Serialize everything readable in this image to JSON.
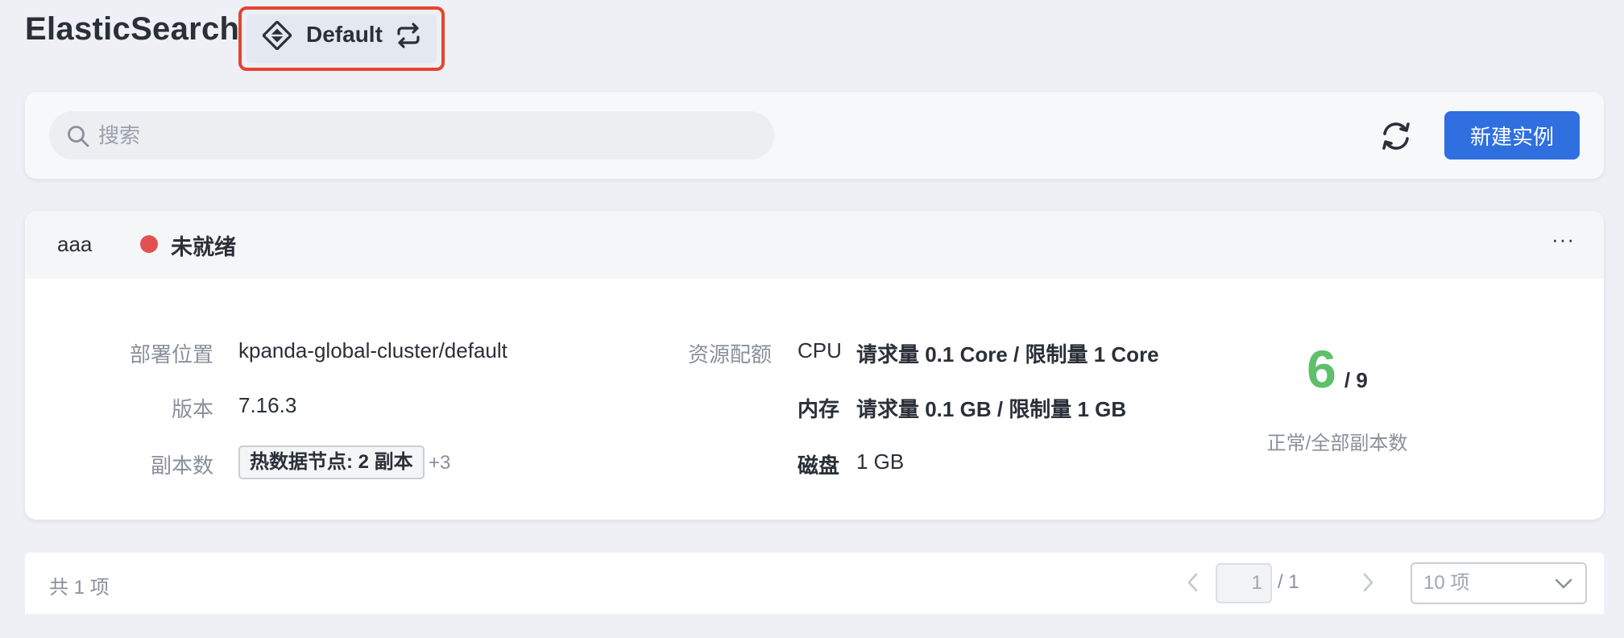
{
  "app": {
    "title": "ElasticSearch",
    "workspace": "Default"
  },
  "toolbar": {
    "search_placeholder": "搜索",
    "search_value": "",
    "new_button_label": "新建实例"
  },
  "instance": {
    "name": "aaa",
    "status_text": "未就绪",
    "status_color": "#e05252",
    "more_label": "···",
    "deploy_label": "部署位置",
    "deploy_value": "kpanda-global-cluster/default",
    "version_label": "版本",
    "version_value": "7.16.3",
    "replicas_label": "副本数",
    "replicas_tag": "热数据节点: 2 副本",
    "replicas_more": "+3",
    "quota_label": "资源配额",
    "cpu_label": "CPU",
    "cpu_value": "请求量 0.1 Core / 限制量 1 Core",
    "mem_label": "内存",
    "mem_value": "请求量 0.1 GB / 限制量 1 GB",
    "disk_label": "磁盘",
    "disk_value": "1 GB",
    "ready_replicas": "6",
    "total_replicas": "/ 9",
    "replicas_ratio_label": "正常/全部副本数"
  },
  "pagination": {
    "total_text": "共 1 项",
    "current_page": "1",
    "page_total": "/ 1",
    "page_size": "10 项"
  },
  "colors": {
    "primary": "#2f6fe0",
    "highlight_border": "#e5432e",
    "ready_green": "#5ec06a"
  },
  "icons": {
    "workspace": "workspace-diamond-icon",
    "swap": "swap-arrows-icon",
    "search": "search-icon",
    "refresh": "refresh-icon",
    "prev": "chevron-left-icon",
    "next": "chevron-right-icon",
    "dropdown": "chevron-down-icon"
  }
}
